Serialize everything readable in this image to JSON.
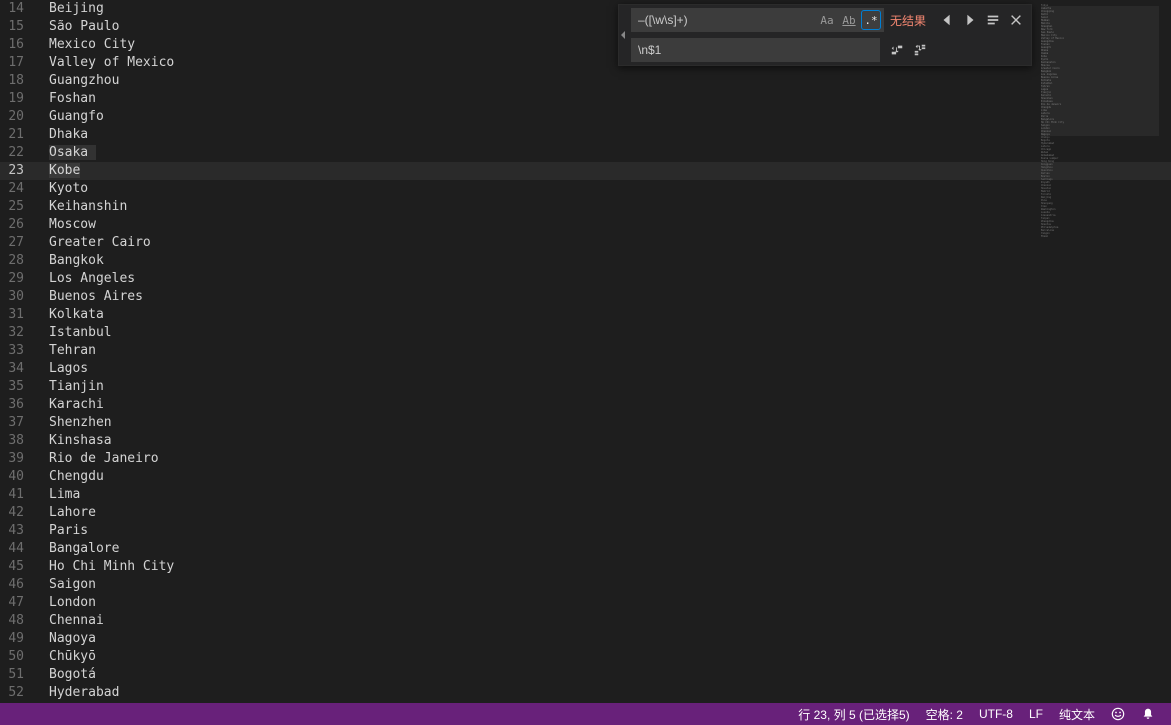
{
  "editor": {
    "first_line_number": 14,
    "current_line": 23,
    "selection_line": 23,
    "prev_highlight_line": 22,
    "lines": [
      "Beijing",
      "São Paulo",
      "Mexico City",
      "Valley of Mexico",
      "Guangzhou",
      "Foshan",
      "Guangfo",
      "Dhaka",
      "Osaka",
      "Kobe",
      "Kyoto",
      "Keihanshin",
      "Moscow",
      "Greater Cairo",
      "Bangkok",
      "Los Angeles",
      "Buenos Aires",
      "Kolkata",
      "Istanbul",
      "Tehran",
      "Lagos",
      "Tianjin",
      "Karachi",
      "Shenzhen",
      "Kinshasa",
      "Rio de Janeiro",
      "Chengdu",
      "Lima",
      "Lahore",
      "Paris",
      "Bangalore",
      "Ho Chi Minh City",
      "Saigon",
      "London",
      "Chennai",
      "Nagoya",
      "Chūkyō",
      "Bogotá",
      "Hyderabad"
    ]
  },
  "find": {
    "search_value": "–([\\w\\s]+)",
    "replace_value": "\\n$1",
    "result_text": "无结果",
    "toggles": {
      "case": "Aa",
      "word": "Ab",
      "regex": ".*"
    },
    "regex_active": true
  },
  "statusbar": {
    "ln_col": "行 23,  列 5 (已选择5)",
    "spaces": "空格: 2",
    "encoding": "UTF-8",
    "eol": "LF",
    "language": "纯文本"
  },
  "minimap_lines": [
    "Tokyo",
    "Jakarta",
    "Chongqing",
    "Delhi",
    "Seoul",
    "Mumbai",
    "Manila",
    "Shanghai",
    "New York",
    "Sao Paulo",
    "Mexico City",
    "Valley of Mexico",
    "Guangzhou",
    "Foshan",
    "Guangfo",
    "Dhaka",
    "Osaka",
    "Kobe",
    "Kyoto",
    "Keihanshin",
    "Moscow",
    "Greater Cairo",
    "Bangkok",
    "Los Angeles",
    "Buenos Aires",
    "Kolkata",
    "Istanbul",
    "Tehran",
    "Lagos",
    "Tianjin",
    "Karachi",
    "Shenzhen",
    "Kinshasa",
    "Rio de Janeiro",
    "Chengdu",
    "Lima",
    "Lahore",
    "Paris",
    "Bangalore",
    "Ho Chi Minh City",
    "Saigon",
    "London",
    "Chennai",
    "Nagoya",
    "Chukyo",
    "Bogota",
    "Hyderabad",
    "Lahore",
    "Chicago",
    "Wuhan",
    "Ahmedabad",
    "Kuala Lumpur",
    "Hong Kong",
    "Dongguan",
    "Hangzhou",
    "Quanzhou",
    "Dallas",
    "Boston",
    "Santiago",
    "Riyadh",
    "Chennai",
    "Houston",
    "Madrid",
    "Toronto",
    "Nanjing",
    "Pune",
    "Shenyang",
    "Xian",
    "Washington",
    "Luanda",
    "Alexandria",
    "Taipei",
    "Zhengzhou",
    "Shantou",
    "Philadelphia",
    "Barcelona",
    "Yangon",
    "Miami"
  ]
}
